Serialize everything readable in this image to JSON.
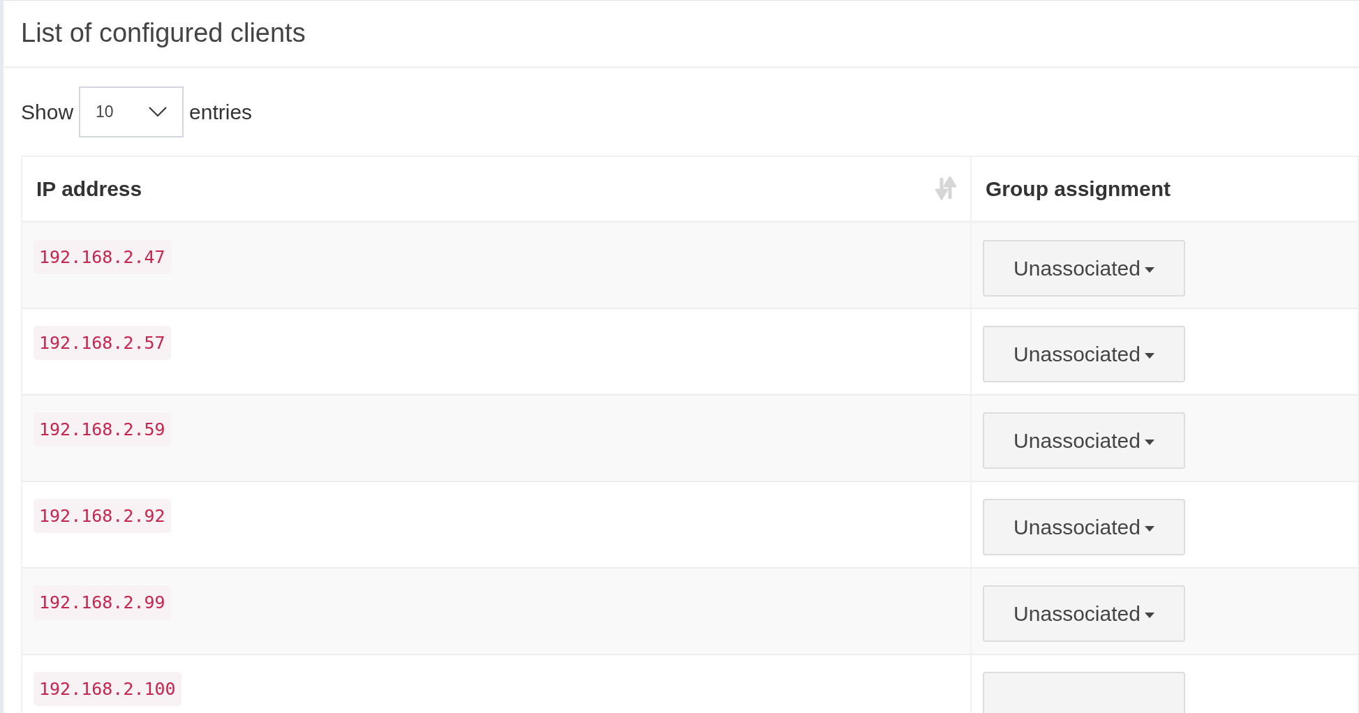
{
  "title": "List of configured clients",
  "length_menu": {
    "prefix": "Show",
    "value": "10",
    "suffix": "entries"
  },
  "table": {
    "columns": [
      {
        "label": "IP address",
        "sortable": true
      },
      {
        "label": "Group assignment",
        "sortable": false
      }
    ],
    "rows": [
      {
        "ip": "192.168.2.47",
        "group": "Unassociated"
      },
      {
        "ip": "192.168.2.57",
        "group": "Unassociated"
      },
      {
        "ip": "192.168.2.59",
        "group": "Unassociated"
      },
      {
        "ip": "192.168.2.92",
        "group": "Unassociated"
      },
      {
        "ip": "192.168.2.99",
        "group": "Unassociated"
      },
      {
        "ip": "192.168.2.100"
      }
    ]
  }
}
